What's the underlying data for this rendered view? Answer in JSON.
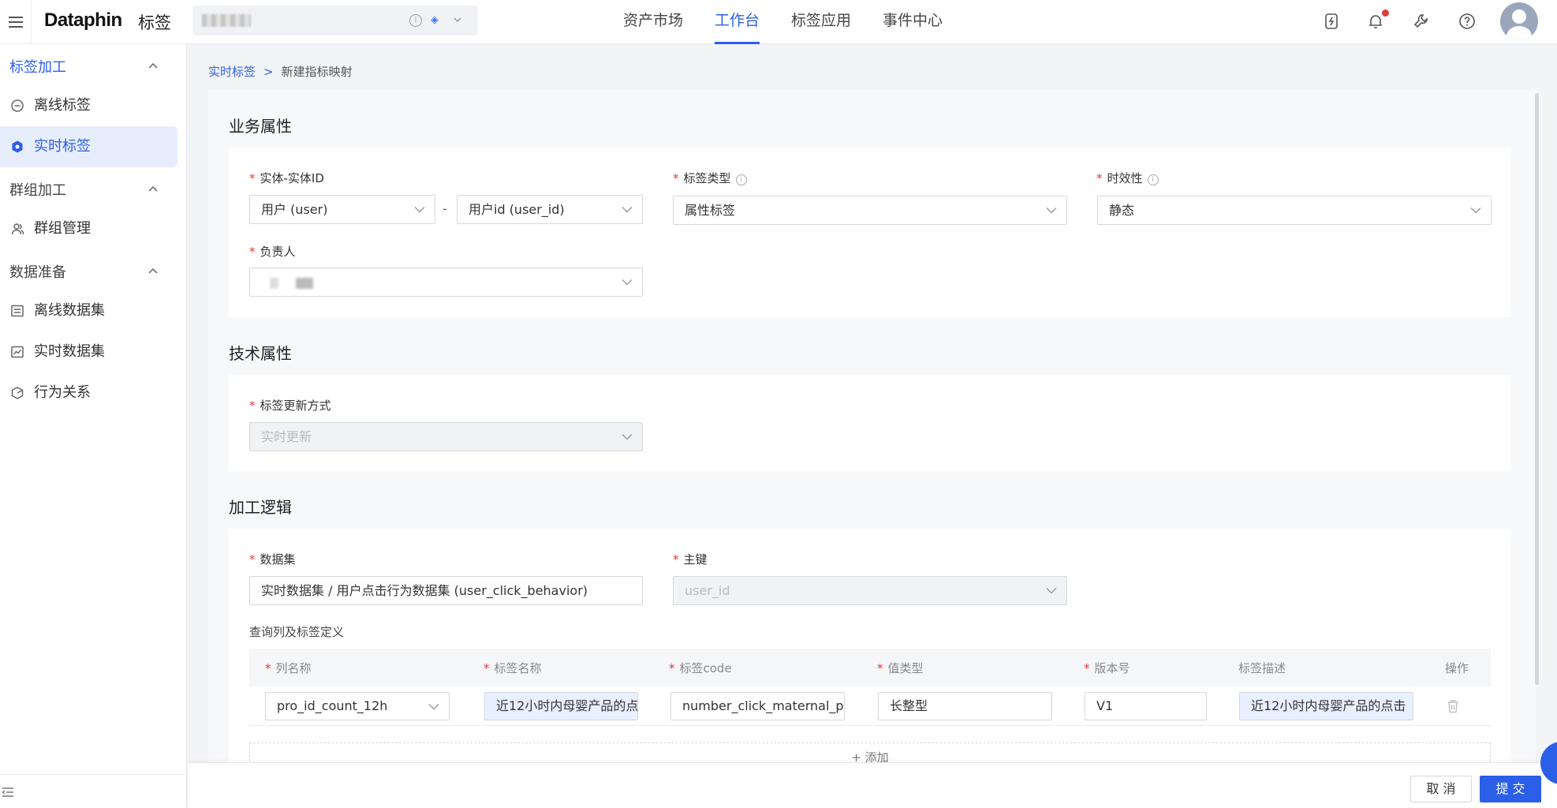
{
  "app": {
    "brand": "Dataphin",
    "module": "标签"
  },
  "top_nav": [
    "资产市场",
    "工作台",
    "标签应用",
    "事件中心"
  ],
  "sidebar": {
    "groups": [
      {
        "label": "标签加工",
        "items": [
          "离线标签",
          "实时标签"
        ]
      },
      {
        "label": "群组加工",
        "items": [
          "群组管理"
        ]
      },
      {
        "label": "数据准备",
        "items": [
          "离线数据集",
          "实时数据集",
          "行为关系"
        ]
      }
    ]
  },
  "breadcrumb": {
    "parent": "实时标签",
    "separator": ">",
    "current": "新建指标映射"
  },
  "sections": {
    "business": "业务属性",
    "technical": "技术属性",
    "logic": "加工逻辑"
  },
  "business": {
    "entity_label": "实体-实体ID",
    "entity_value": "用户 (user)",
    "entity_id_value": "用户id (user_id)",
    "dash": "-",
    "tag_type_label": "标签类型",
    "tag_type_value": "属性标签",
    "timeliness_label": "时效性",
    "timeliness_value": "静态",
    "owner_label": "负责人"
  },
  "technical": {
    "update_label": "标签更新方式",
    "update_value": "实时更新"
  },
  "logic": {
    "dataset_label": "数据集",
    "dataset_value": "实时数据集 / 用户点击行为数据集 (user_click_behavior)",
    "pk_label": "主键",
    "pk_value": "user_id",
    "query_label": "查询列及标签定义",
    "columns": [
      "列名称",
      "标签名称",
      "标签code",
      "值类型",
      "版本号",
      "标签描述",
      "操作"
    ],
    "row": {
      "column_name": "pro_id_count_12h",
      "tag_name": "近12小时内母婴产品的点",
      "tag_code": "number_click_maternal_p",
      "value_type": "长整型",
      "version": "V1",
      "description": "近12小时内母婴产品的点击"
    },
    "add_label": "+ 添加"
  },
  "footer": {
    "cancel": "取 消",
    "submit": "提 交"
  },
  "colors": {
    "accent": "#2c5fe8",
    "required": "#e33333"
  }
}
